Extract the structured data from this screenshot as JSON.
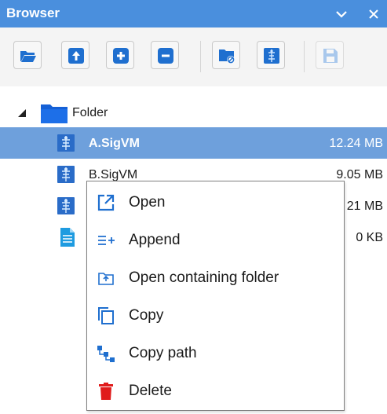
{
  "panel": {
    "title": "Browser",
    "dropdown_icon": "chevron-down-icon",
    "close_icon": "close-icon"
  },
  "toolbar": {
    "buttons": [
      {
        "name": "open-folder-icon"
      },
      {
        "name": "arrow-up-icon"
      },
      {
        "name": "plus-icon"
      },
      {
        "name": "minus-icon"
      },
      {
        "name": "folder-remove-icon"
      },
      {
        "name": "signal-file-icon"
      },
      {
        "name": "save-icon",
        "disabled": true
      }
    ]
  },
  "tree": {
    "folder_label": "Folder",
    "items": [
      {
        "name": "A.SigVM",
        "size": "12.24 MB",
        "selected": true,
        "icon": "sigvm-file-icon"
      },
      {
        "name": "B.SigVM",
        "size": "9.05 MB",
        "icon": "sigvm-file-icon"
      },
      {
        "name": "",
        "size": "21 MB",
        "icon": "sigvm-file-icon"
      },
      {
        "name": "",
        "size": "0 KB",
        "icon": "document-icon"
      }
    ]
  },
  "context_menu": {
    "items": [
      {
        "label": "Open",
        "icon": "open-external-icon"
      },
      {
        "label": "Append",
        "icon": "append-icon"
      },
      {
        "label": "Open containing folder",
        "icon": "open-folder-outline-icon"
      },
      {
        "label": "Copy",
        "icon": "copy-icon"
      },
      {
        "label": "Copy path",
        "icon": "copy-path-icon"
      },
      {
        "label": "Delete",
        "icon": "trash-icon"
      }
    ]
  },
  "colors": {
    "accent": "#4a8fdd",
    "selection": "#6ea0dc",
    "toolbar_icon": "#1f6fcf",
    "delete_red": "#e01b1b"
  }
}
